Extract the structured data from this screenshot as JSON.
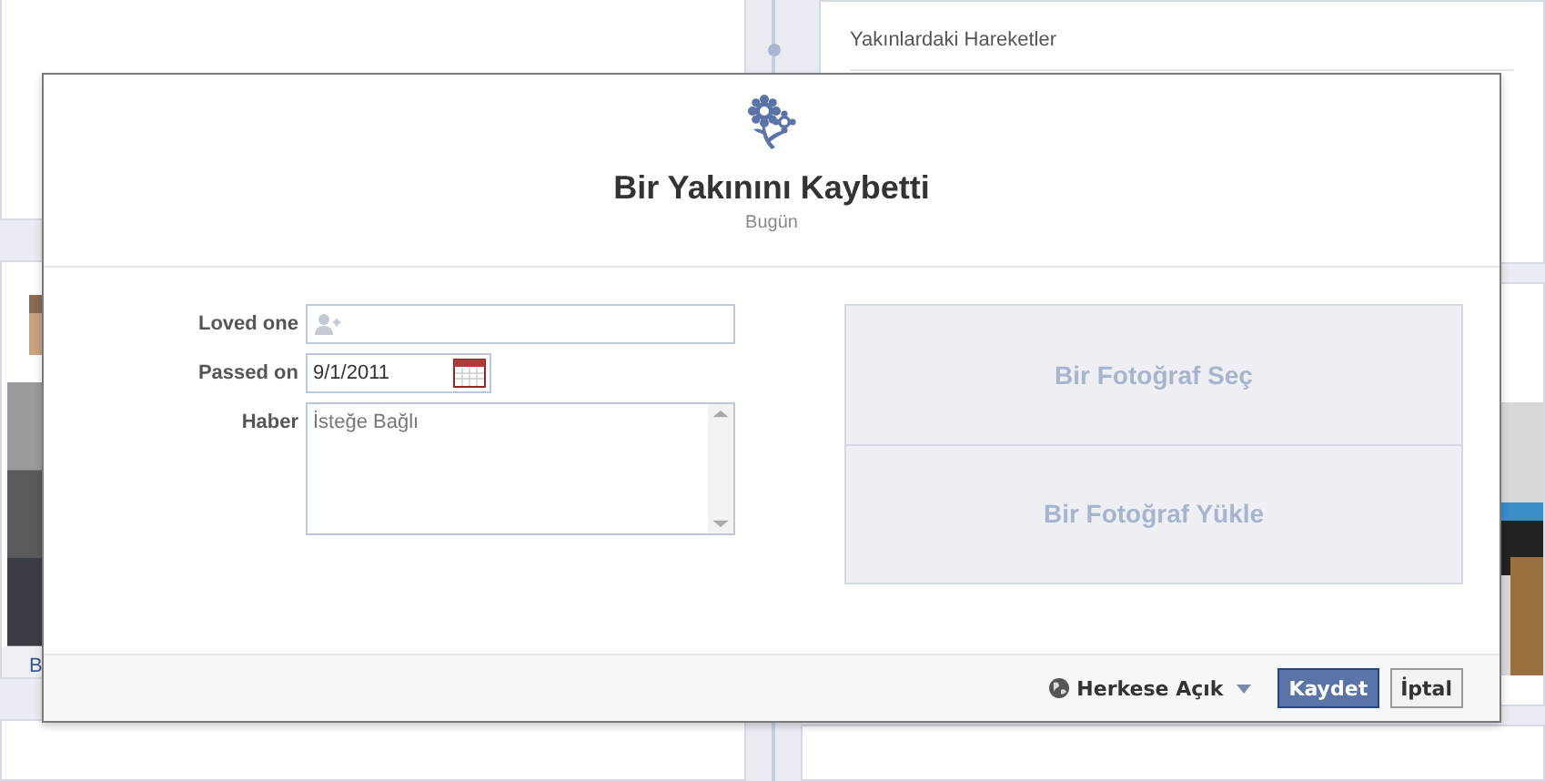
{
  "background": {
    "nearby_title": "Yakınlardaki Hareketler",
    "story_fragment": "B"
  },
  "dialog": {
    "title": "Bir Yakınını Kaybetti",
    "subtitle": "Bugün",
    "fields": [
      {
        "kind": "person",
        "label": "Loved one"
      },
      {
        "kind": "date",
        "label": "Passed on",
        "value": "9/1/2011"
      },
      {
        "kind": "textarea",
        "label": "Haber",
        "placeholder": "İsteğe Bağlı"
      }
    ],
    "photo_options": [
      "Bir Fotoğraf Seç",
      "Bir Fotoğraf Yükle"
    ],
    "privacy": "Herkese Açık",
    "buttons": [
      {
        "kind": "primary",
        "label": "Kaydet"
      },
      {
        "kind": "secondary",
        "label": "İptal"
      }
    ]
  }
}
